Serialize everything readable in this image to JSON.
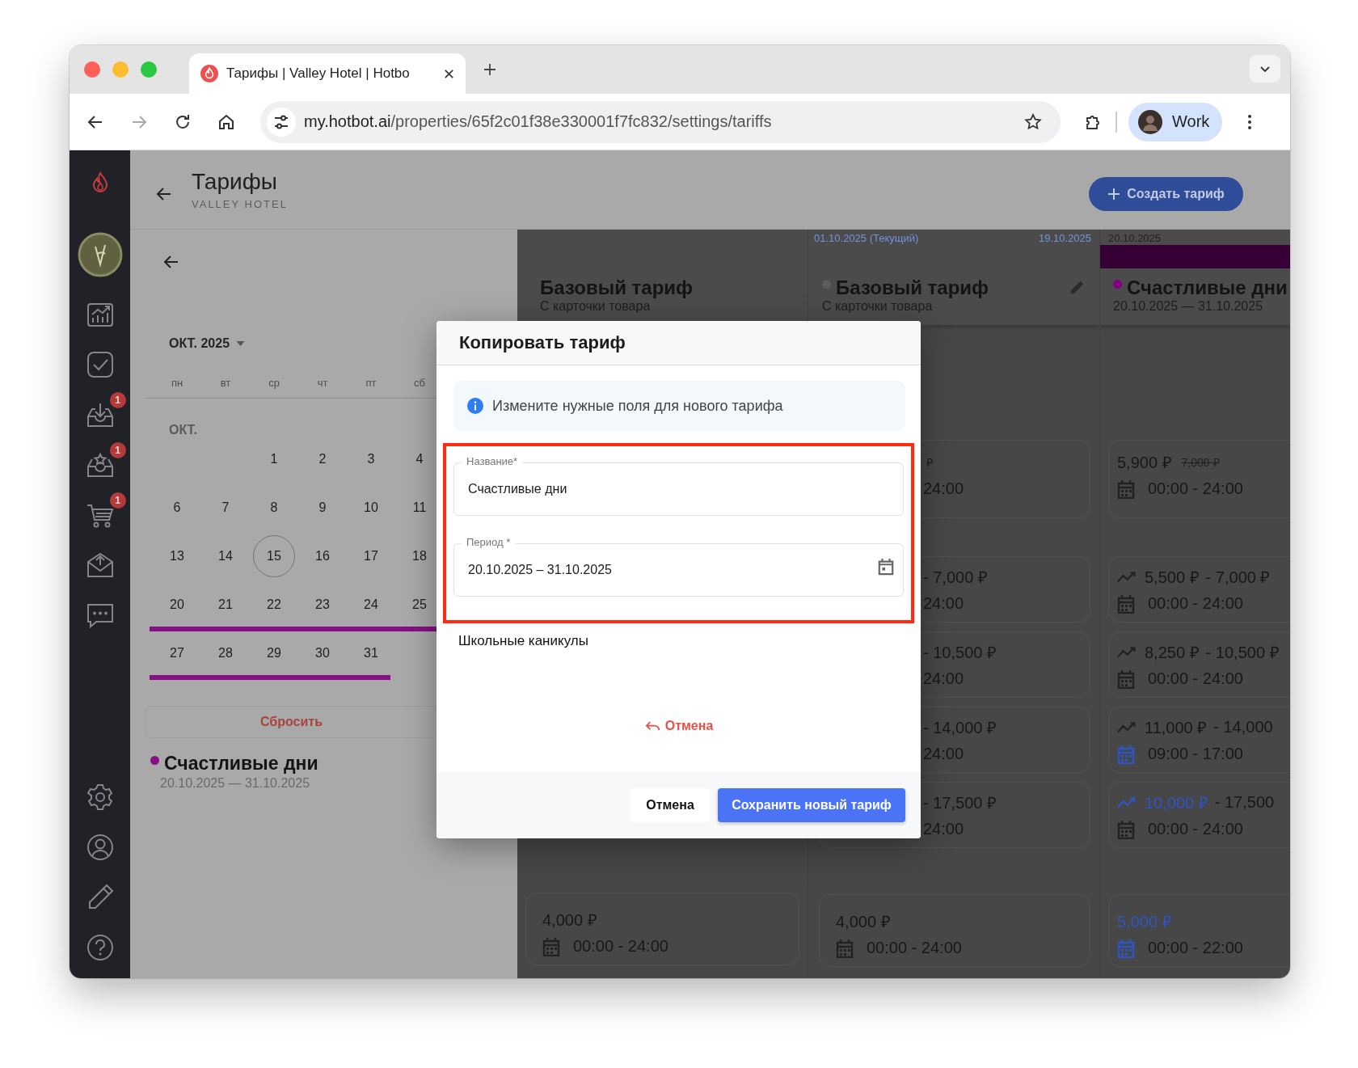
{
  "browser": {
    "tab_title": "Тарифы | Valley Hotel | Hotbo",
    "url_host": "my.hotbot.ai",
    "url_path": "/properties/65f2c01f38e330001f7fc832/settings/tariffs",
    "profile": "Work"
  },
  "sidebar": {
    "badges": [
      "1",
      "1",
      "1"
    ]
  },
  "header": {
    "title": "Тарифы",
    "subtitle": "VALLEY HOTEL",
    "create_button": "Создать тариф"
  },
  "calendar": {
    "month_picker": "ОКТ. 2025",
    "weekdays": [
      "пн",
      "вт",
      "ср",
      "чт",
      "пт",
      "сб"
    ],
    "month_label": "ОКТ.",
    "weeks": [
      {
        "days": [
          {
            "kind": "blank"
          },
          {
            "kind": "blank"
          },
          {
            "kind": "day",
            "label": "1",
            "today": false
          },
          {
            "kind": "day",
            "label": "2",
            "today": false
          },
          {
            "kind": "day",
            "label": "3",
            "today": false
          },
          {
            "kind": "day",
            "label": "4",
            "today": false
          }
        ]
      },
      {
        "days": [
          {
            "kind": "day",
            "label": "6",
            "today": false
          },
          {
            "kind": "day",
            "label": "7",
            "today": false
          },
          {
            "kind": "day",
            "label": "8",
            "today": false
          },
          {
            "kind": "day",
            "label": "9",
            "today": false
          },
          {
            "kind": "day",
            "label": "10",
            "today": false
          },
          {
            "kind": "day",
            "label": "11",
            "today": false
          }
        ]
      },
      {
        "days": [
          {
            "kind": "day",
            "label": "13",
            "today": false
          },
          {
            "kind": "day",
            "label": "14",
            "today": false
          },
          {
            "kind": "day",
            "label": "15",
            "today": true
          },
          {
            "kind": "day",
            "label": "16",
            "today": false
          },
          {
            "kind": "day",
            "label": "17",
            "today": false
          },
          {
            "kind": "day",
            "label": "18",
            "today": false
          }
        ]
      },
      {
        "color": "#860f86",
        "days": [
          {
            "kind": "day",
            "label": "20",
            "today": false
          },
          {
            "kind": "day",
            "label": "21",
            "today": false
          },
          {
            "kind": "day",
            "label": "22",
            "today": false
          },
          {
            "kind": "day",
            "label": "23",
            "today": false
          },
          {
            "kind": "day",
            "label": "24",
            "today": false
          },
          {
            "kind": "day",
            "label": "25",
            "today": false
          }
        ]
      },
      {
        "color": "#860f86",
        "days": [
          {
            "kind": "day",
            "label": "27",
            "today": false
          },
          {
            "kind": "day",
            "label": "28",
            "today": false
          },
          {
            "kind": "day",
            "label": "29",
            "today": false
          },
          {
            "kind": "day",
            "label": "30",
            "today": false
          },
          {
            "kind": "day",
            "label": "31",
            "today": false
          }
        ]
      }
    ],
    "reset_button": {
      "label": "Сбросить",
      "disabled": true
    }
  },
  "legend": {
    "name": "Счастливые дни",
    "period": "20.10.2025 — 31.10.2025",
    "color": "#860f86"
  },
  "tariff_columns": [
    {
      "title": "Базовый тариф",
      "subtitle": "С карточки товара",
      "editable": false,
      "base_cell": {
        "price_from": "4,000 ₽",
        "time": "00:00 - 24:00",
        "trend": false,
        "calendar": true,
        "accent": false,
        "time_accent": false
      }
    },
    {
      "date_start": "01.10.2025 (Текущий)",
      "date_end": "19.10.2025",
      "color": "#5c5c5c",
      "title": "Базовый тариф",
      "subtitle": "С карточки товара",
      "editable": true,
      "cells": [
        {
          "old_price": "₽",
          "time": "24:00",
          "trend": false,
          "calendar": false
        },
        {
          "price_to": "- 7,000 ₽",
          "time": "24:00",
          "trend": false,
          "calendar": false
        },
        {
          "price_to": "- 10,500 ₽",
          "time": "24:00",
          "trend": false,
          "calendar": false
        },
        {
          "price_to": "- 14,000 ₽",
          "time": "24:00",
          "trend": false,
          "calendar": false
        },
        {
          "price_to": "- 17,500 ₽",
          "time": "24:00",
          "trend": false,
          "calendar": false
        }
      ],
      "base_cell": {
        "price_from": "4,000 ₽",
        "time": "00:00 - 24:00",
        "trend": false,
        "calendar": true,
        "accent": false,
        "time_accent": false
      }
    },
    {
      "date_start": "20.10.2025",
      "color": "#800080",
      "title": "Счастливые дни",
      "subtitle": "20.10.2025 — 31.10.2025",
      "editable": false,
      "cells": [
        {
          "price_from": "5,900 ₽",
          "old_price": "7,000 ₽",
          "time": "00:00 - 24:00",
          "trend": false,
          "calendar": true,
          "accent": false,
          "time_accent": false
        },
        {
          "price_from": "5,500 ₽",
          "price_to": "- 7,000 ₽",
          "time": "00:00 - 24:00",
          "trend": true,
          "calendar": true,
          "accent": false,
          "time_accent": false
        },
        {
          "price_from": "8,250 ₽",
          "price_to": "- 10,500 ₽",
          "time": "00:00 - 24:00",
          "trend": true,
          "calendar": true,
          "accent": false,
          "time_accent": false
        },
        {
          "price_from": "11,000 ₽",
          "price_to": "- 14,000",
          "time": "09:00 - 17:00",
          "trend": true,
          "calendar": true,
          "accent": false,
          "time_accent": true
        },
        {
          "price_from": "10,000 ₽",
          "price_to": "- 17,500",
          "time": "00:00 - 24:00",
          "trend": true,
          "calendar": true,
          "accent": true,
          "time_accent": false
        }
      ],
      "base_cell": {
        "price_from": "5,000 ₽",
        "time": "00:00 - 22:00",
        "trend": false,
        "calendar": true,
        "accent": true,
        "time_accent": true
      }
    }
  ],
  "dialog": {
    "title": "Копировать тариф",
    "info": "Измените нужные поля для нового тарифа",
    "highlighted": true,
    "fields": [
      {
        "kind": "text",
        "label": "Название*",
        "value": "Счастливые дни"
      },
      {
        "kind": "date",
        "label": "Период *",
        "value": "20.10.2025 – 31.10.2025"
      }
    ],
    "suggestion": "Школьные каникулы",
    "undo_link": "Отмена",
    "buttons": [
      {
        "kind": "secondary",
        "label": "Отмена"
      },
      {
        "kind": "primary",
        "label": "Сохранить новый тариф"
      }
    ]
  }
}
